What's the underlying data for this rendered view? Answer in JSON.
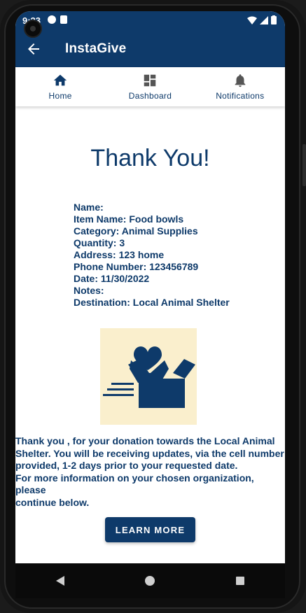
{
  "status_bar": {
    "time": "9:23"
  },
  "app_bar": {
    "title": "InstaGive"
  },
  "nav": [
    {
      "label": "Home",
      "icon": "home-icon"
    },
    {
      "label": "Dashboard",
      "icon": "dashboard-icon"
    },
    {
      "label": "Notifications",
      "icon": "bell-icon"
    }
  ],
  "main": {
    "title": "Thank You!",
    "details": [
      "Name:",
      "Item Name: Food bowls",
      "Category: Animal Supplies",
      "Quantity: 3",
      "Address: 123 home",
      "Phone Number: 123456789",
      "Date: 11/30/2022",
      "Notes:",
      "Destination: Local Animal Shelter"
    ],
    "message_lines": [
      "Thank you , for your donation towards the Local Animal",
      "Shelter. You will be receiving updates, via the cell number",
      "provided, 1-2 days prior to your requested date.",
      "For more information on your chosen organization, please",
      "continue below."
    ],
    "learn_more_label": "LEARN MORE"
  },
  "colors": {
    "primary": "#0e3a6a",
    "illustration_bg": "#faefcd"
  }
}
